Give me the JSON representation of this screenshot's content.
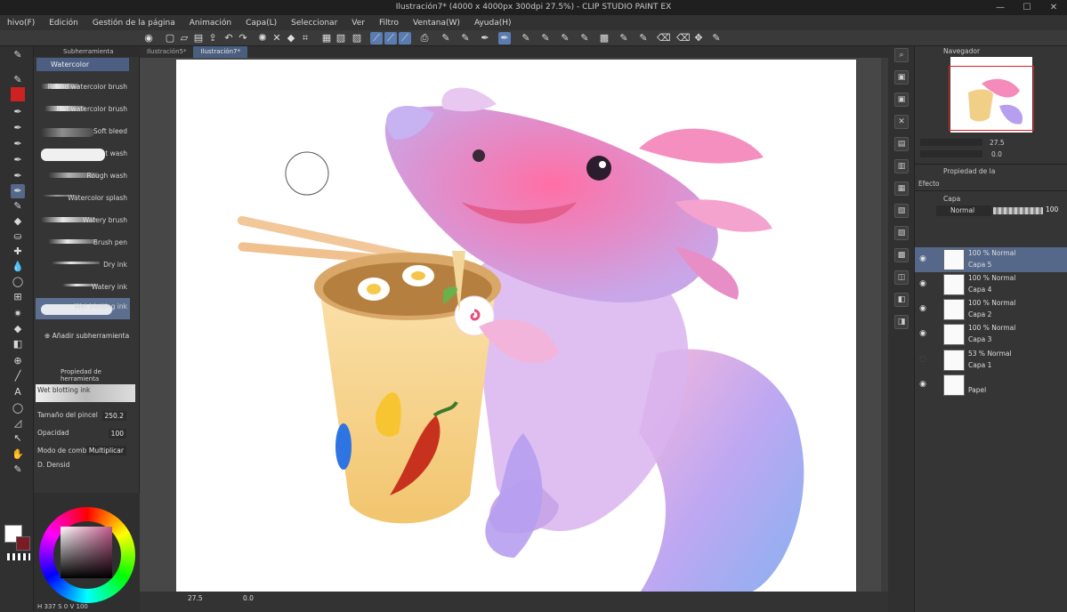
{
  "window": {
    "title": "Ilustración7* (4000 x 4000px 300dpi 27.5%) - CLIP STUDIO PAINT EX",
    "controls": [
      "—",
      "☐",
      "✕"
    ]
  },
  "menu": [
    "hivo(F)",
    "Edición",
    "Gestión de la página",
    "Animación",
    "Capa(L)",
    "Seleccionar",
    "Ver",
    "Filtro",
    "Ventana(W)",
    "Ayuda(H)"
  ],
  "tabs": [
    "Ilustración5*",
    "Ilustración7*"
  ],
  "subtool": {
    "header": "Subherramienta",
    "group": "Watercolor",
    "items": [
      "Round watercolor brush",
      "Flat watercolor brush",
      "Soft bleed",
      "Wet wash",
      "Rough wash",
      "Watercolor splash",
      "Watery brush",
      "Brush pen",
      "Dry ink",
      "Watery ink",
      "Wet blotting ink"
    ],
    "add_label": "Añadir subherramienta"
  },
  "tool_property": {
    "header": "Propiedad de herramienta",
    "tool_name": "Wet blotting ink",
    "brush_size_label": "Tamaño del pincel",
    "brush_size_value": "250.2",
    "opacity_label": "Opacidad",
    "opacity_value": "100",
    "blend_label": "Modo de combinaci",
    "blend_value": "Multiplicar",
    "density_label": "D. Densid"
  },
  "color": {
    "foreground": "#ffffff",
    "background": "#7a1b25",
    "hue_accent": "#c25a8b",
    "readout": "337",
    "readout2": "0",
    "readout3": "100"
  },
  "canvas": {
    "zoom": "27.5",
    "rotation": "0.0",
    "accent_tab": "#4a5f80"
  },
  "navigator": {
    "header": "Navegador",
    "zoom": "27.5",
    "rotation": "0.0"
  },
  "layer_property": {
    "header": "Propiedad de la",
    "effect": "Efecto"
  },
  "layers": {
    "header": "Capa",
    "blend_mode": "Normal",
    "opacity": "100",
    "items": [
      {
        "line1": "100 % Normal",
        "line2": "Capa 5",
        "visible": true,
        "selected": true
      },
      {
        "line1": "100 % Normal",
        "line2": "Capa 4",
        "visible": true,
        "selected": false
      },
      {
        "line1": "100 % Normal",
        "line2": "Capa 2",
        "visible": true,
        "selected": false
      },
      {
        "line1": "100 % Normal",
        "line2": "Capa 3",
        "visible": true,
        "selected": false
      },
      {
        "line1": "53 % Normal",
        "line2": "Capa 1",
        "visible": false,
        "selected": false
      },
      {
        "line1": "",
        "line2": "Papel",
        "visible": true,
        "selected": false
      }
    ]
  }
}
